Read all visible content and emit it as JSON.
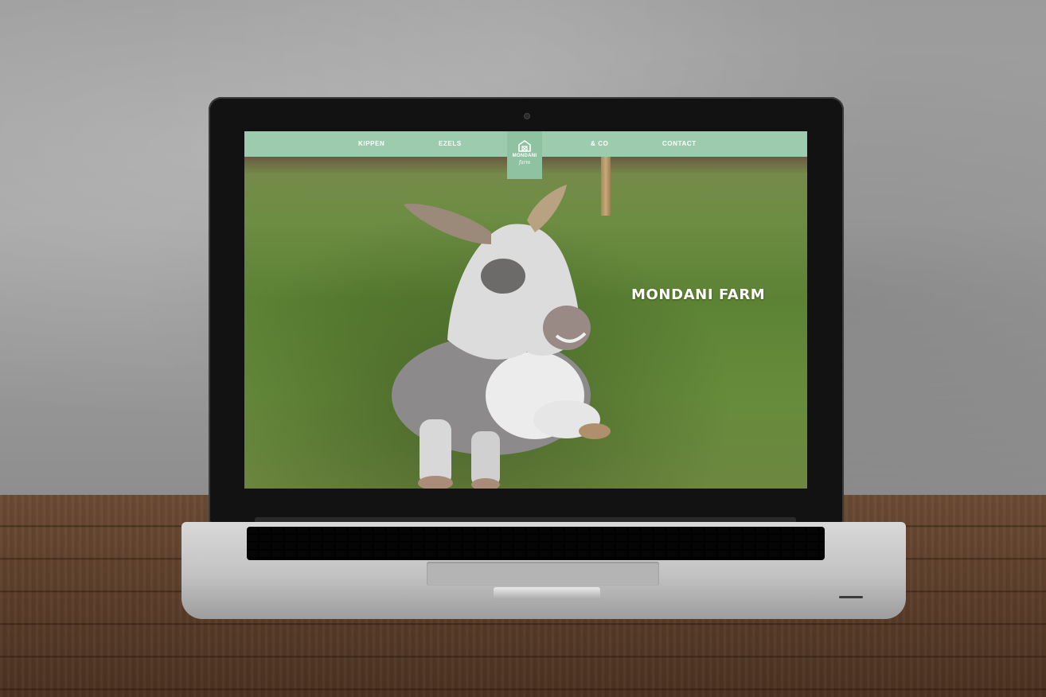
{
  "site": {
    "nav": {
      "items": [
        {
          "label": "KIPPEN"
        },
        {
          "label": "EZELS"
        },
        {
          "label": "& CO"
        },
        {
          "label": "CONTACT"
        }
      ],
      "logo": {
        "name": "MONDANI",
        "sub": "farm",
        "icon": "barn-icon"
      }
    },
    "hero": {
      "title": "MONDANI FARM",
      "image": "donkey-photo"
    }
  },
  "colors": {
    "nav_bg": "#9dcbae",
    "logo_bg": "#8ec2a1",
    "nav_text": "#ffffff"
  }
}
